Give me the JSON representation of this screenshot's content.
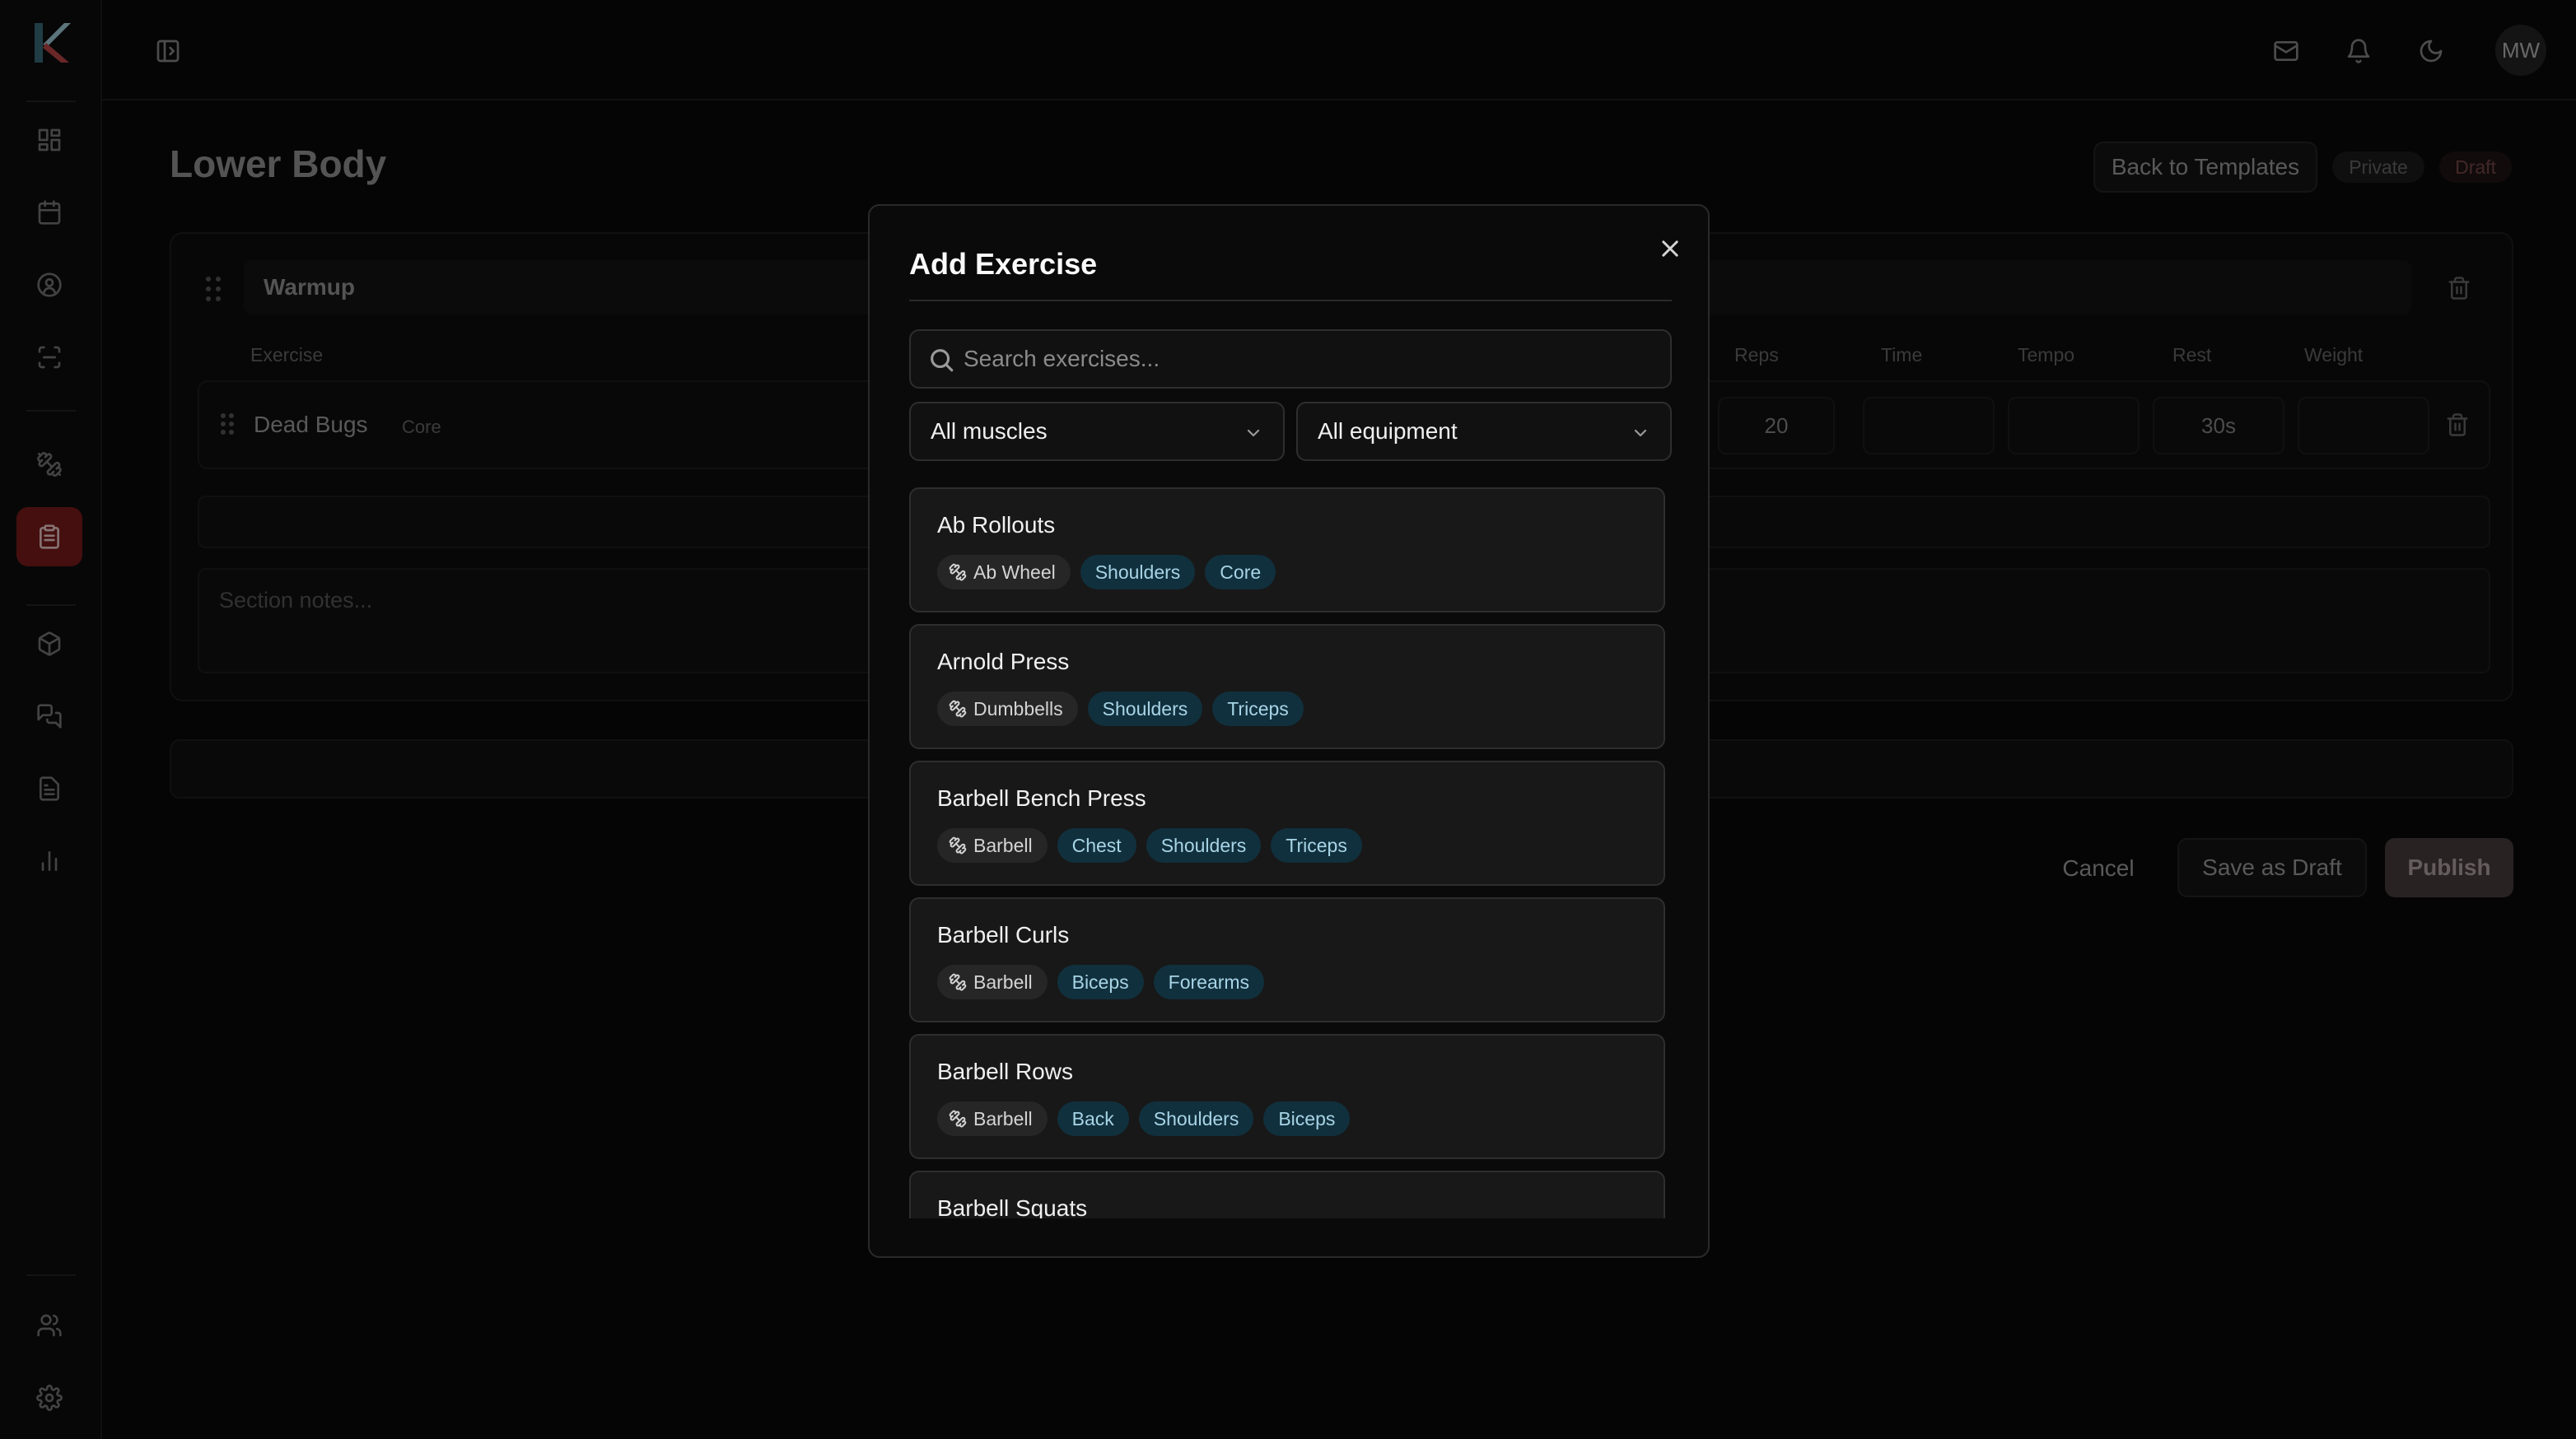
{
  "app": {
    "logo_letter": "K"
  },
  "sidebar": {
    "items": [
      {
        "icon": "dashboard-icon"
      },
      {
        "icon": "calendar-icon"
      },
      {
        "icon": "user-circle-icon"
      },
      {
        "icon": "scan-icon"
      },
      {
        "icon": "dumbbell-icon"
      },
      {
        "icon": "clipboard-icon",
        "active": true
      },
      {
        "icon": "package-icon"
      },
      {
        "icon": "messages-icon"
      },
      {
        "icon": "file-text-icon"
      },
      {
        "icon": "chart-icon"
      },
      {
        "icon": "users-icon"
      },
      {
        "icon": "settings-icon"
      }
    ]
  },
  "header": {
    "avatar_initials": "MW"
  },
  "page": {
    "title": "Lower Body",
    "back_label": "Back to Templates",
    "badge_private": "Private",
    "badge_draft": "Draft",
    "cancel_label": "Cancel",
    "save_draft_label": "Save as Draft",
    "publish_label": "Publish"
  },
  "section": {
    "name": "Warmup",
    "columns": {
      "exercise": "Exercise",
      "reps": "Reps",
      "time": "Time",
      "tempo": "Tempo",
      "rest": "Rest",
      "weight": "Weight"
    },
    "row": {
      "name": "Dead Bugs",
      "category": "Core",
      "reps": "20",
      "time": "",
      "tempo": "",
      "rest": "30s",
      "weight": ""
    },
    "notes_placeholder": "Section notes..."
  },
  "modal": {
    "title": "Add Exercise",
    "search_placeholder": "Search exercises...",
    "muscle_filter": "All muscles",
    "equipment_filter": "All equipment",
    "exercises": [
      {
        "name": "Ab Rollouts",
        "equipment": "Ab Wheel",
        "muscles": [
          "Shoulders",
          "Core"
        ]
      },
      {
        "name": "Arnold Press",
        "equipment": "Dumbbells",
        "muscles": [
          "Shoulders",
          "Triceps"
        ]
      },
      {
        "name": "Barbell Bench Press",
        "equipment": "Barbell",
        "muscles": [
          "Chest",
          "Shoulders",
          "Triceps"
        ]
      },
      {
        "name": "Barbell Curls",
        "equipment": "Barbell",
        "muscles": [
          "Biceps",
          "Forearms"
        ]
      },
      {
        "name": "Barbell Rows",
        "equipment": "Barbell",
        "muscles": [
          "Back",
          "Shoulders",
          "Biceps"
        ]
      },
      {
        "name": "Barbell Squats",
        "equipment": "",
        "muscles": []
      }
    ]
  },
  "colors": {
    "accent": "#7f1d1d",
    "muscle_tag_bg": "#11303d",
    "muscle_tag_text": "#a7d4e6"
  }
}
